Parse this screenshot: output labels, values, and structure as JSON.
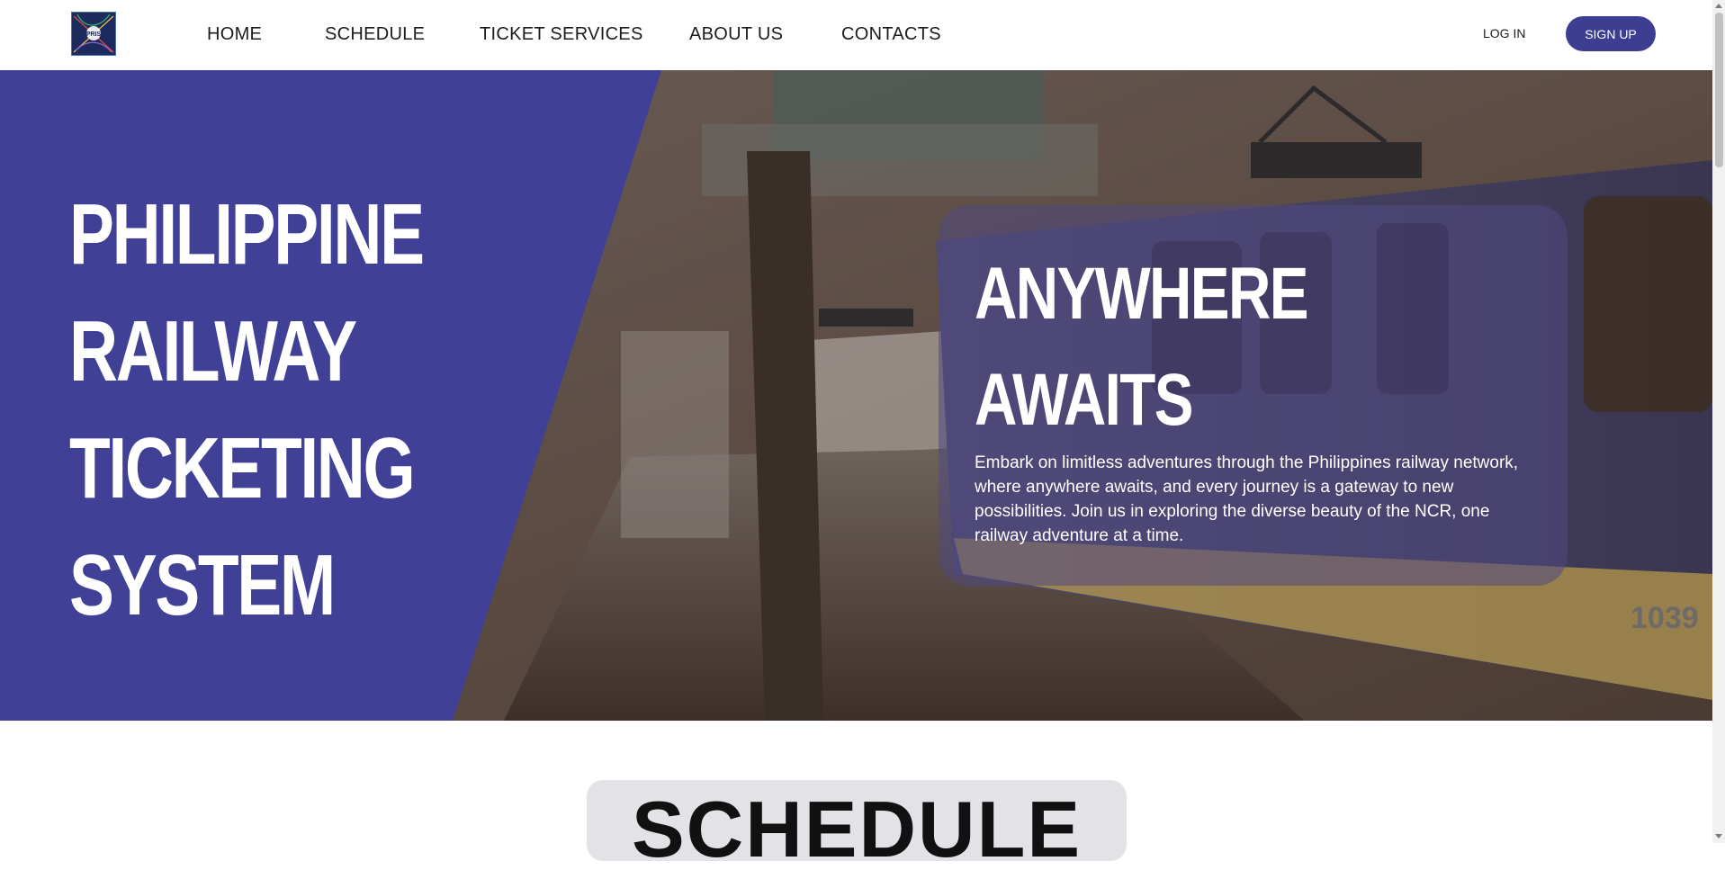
{
  "brand": {
    "logo_text": "PRIS"
  },
  "nav": [
    {
      "label": "HOME"
    },
    {
      "label": "SCHEDULE"
    },
    {
      "label": "TICKET SERVICES"
    },
    {
      "label": "ABOUT US"
    },
    {
      "label": "CONTACTS"
    }
  ],
  "auth": {
    "login_label": "LOG IN",
    "signup_label": "SIGN UP"
  },
  "hero": {
    "title_lines": [
      "PHILIPPINE",
      "RAILWAY",
      "TICKETING",
      "SYSTEM"
    ],
    "card": {
      "title_lines": [
        "ANYWHERE",
        "AWAITS"
      ],
      "text": "Embark on limitless adventures through the Philippines railway network, where anywhere awaits, and every journey is a gateway to new possibilities. Join us in exploring the diverse beauty of the NCR, one railway adventure at a time."
    },
    "background_number": "1039"
  },
  "schedule": {
    "title": "SCHEDULE"
  },
  "colors": {
    "accent": "#3d3d92",
    "panel": "#3f4096",
    "white": "#ffffff"
  }
}
